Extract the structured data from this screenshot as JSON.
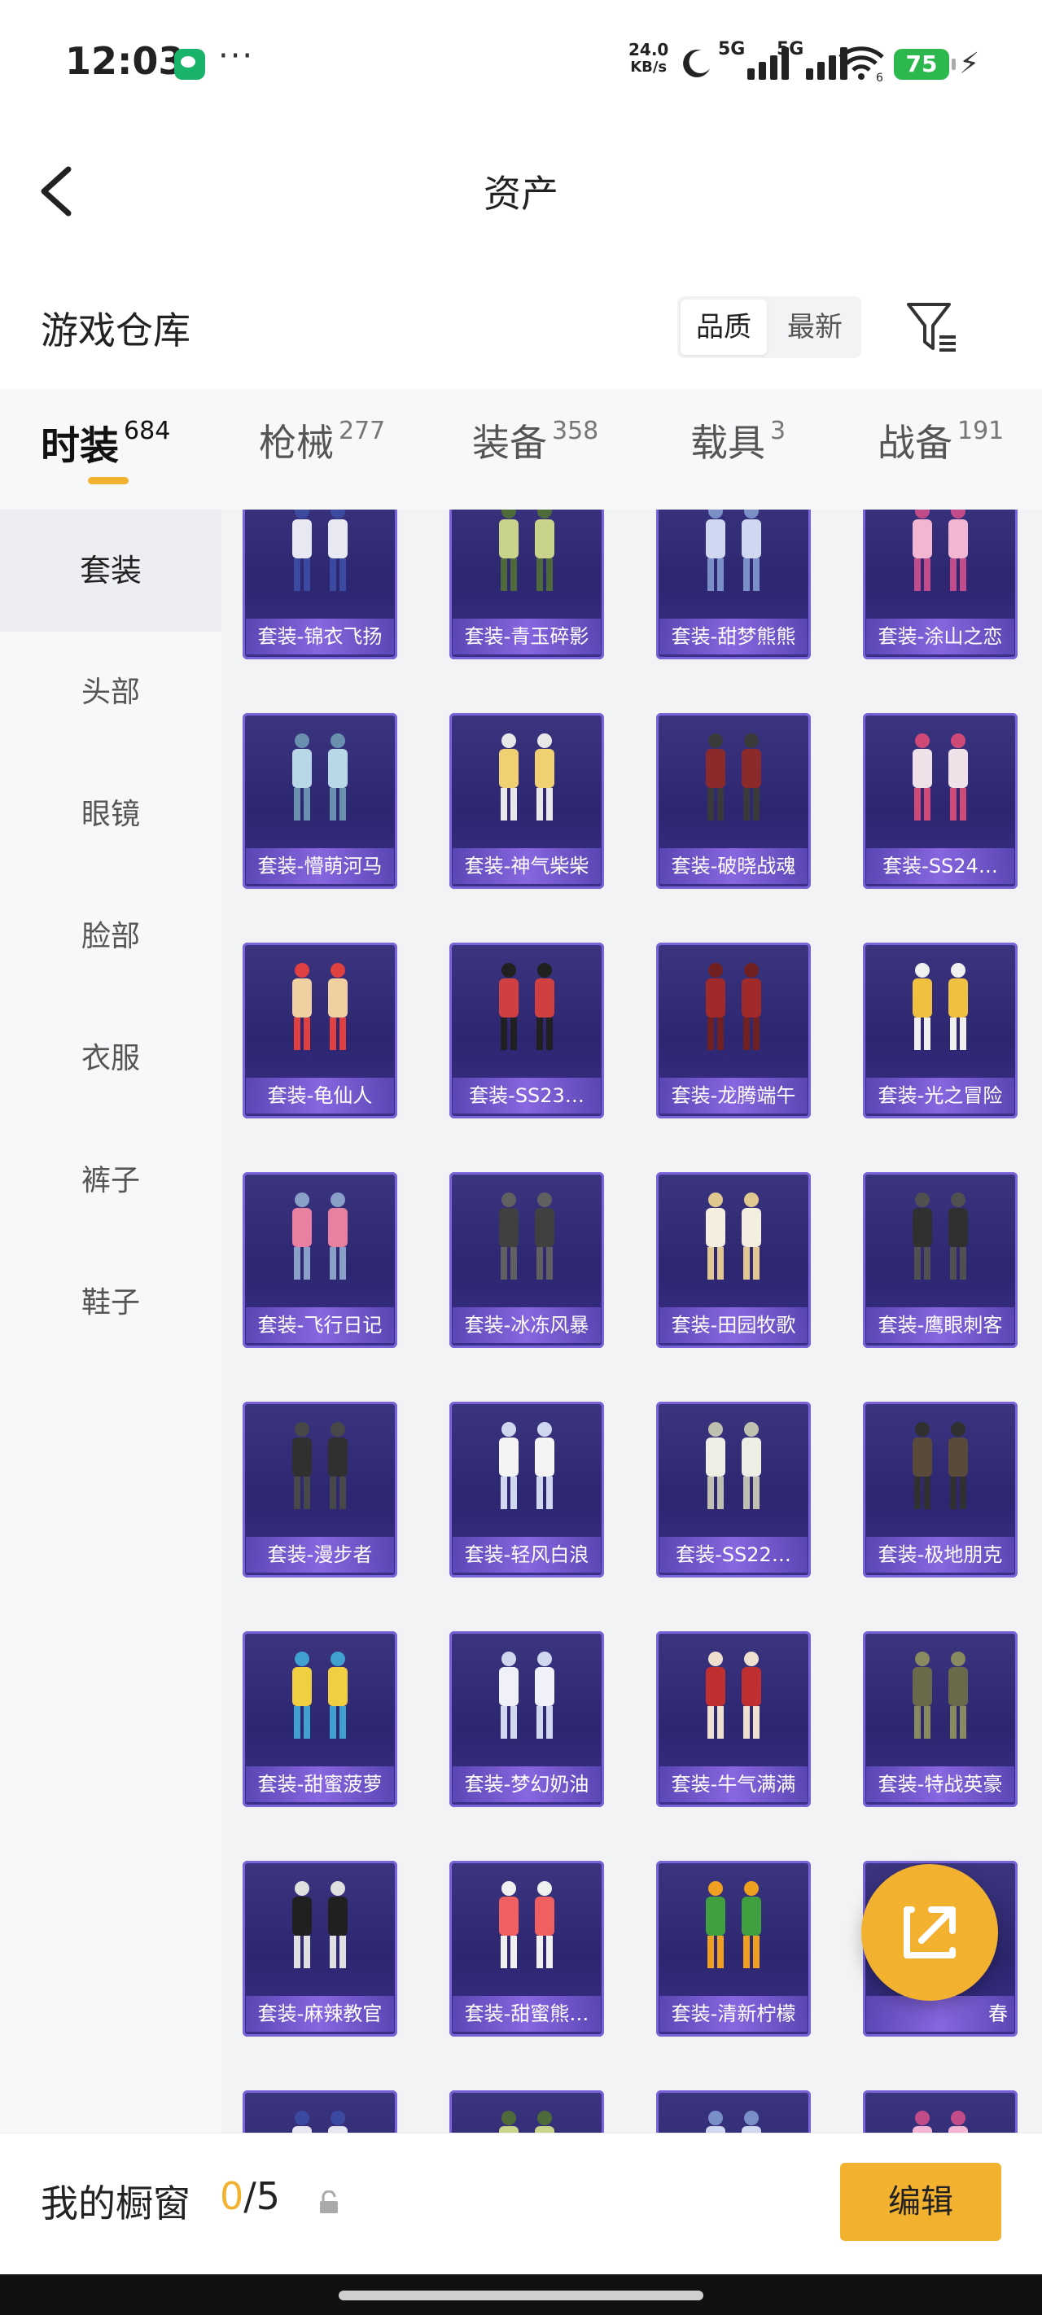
{
  "status_bar": {
    "time": "12:03",
    "more": "···",
    "net_speed": "24.0",
    "net_unit": "KB/s",
    "sim1": "5G",
    "sim2": "5G",
    "wifi_sub": "6",
    "battery": "75",
    "icons": [
      "wechat-icon",
      "moon-icon",
      "signal-icon",
      "signal-icon",
      "wifi-icon",
      "battery-icon",
      "charging-icon"
    ]
  },
  "header": {
    "title": "资产",
    "back_icon": "chevron-left-icon"
  },
  "warehouse": {
    "title": "游戏仓库",
    "sort_options": [
      {
        "label": "品质",
        "active": true
      },
      {
        "label": "最新",
        "active": false
      }
    ],
    "filter_icon": "filter-icon"
  },
  "category_tabs": [
    {
      "label": "时装",
      "count": "684",
      "active": true
    },
    {
      "label": "枪械",
      "count": "277",
      "active": false
    },
    {
      "label": "装备",
      "count": "358",
      "active": false
    },
    {
      "label": "载具",
      "count": "3",
      "active": false
    },
    {
      "label": "战备",
      "count": "191",
      "active": false
    }
  ],
  "sidebar": [
    {
      "label": "套装",
      "active": true
    },
    {
      "label": "头部",
      "active": false
    },
    {
      "label": "眼镜",
      "active": false
    },
    {
      "label": "脸部",
      "active": false
    },
    {
      "label": "衣服",
      "active": false
    },
    {
      "label": "裤子",
      "active": false
    },
    {
      "label": "鞋子",
      "active": false
    }
  ],
  "items": [
    {
      "label": "套装-锦衣飞扬"
    },
    {
      "label": "套装-青玉碎影"
    },
    {
      "label": "套装-甜梦熊熊"
    },
    {
      "label": "套装-涂山之恋"
    },
    {
      "label": "套装-懵萌河马"
    },
    {
      "label": "套装-神气柴柴"
    },
    {
      "label": "套装-破晓战魂"
    },
    {
      "label": "套装-SS24…"
    },
    {
      "label": "套装-龟仙人"
    },
    {
      "label": "套装-SS23…"
    },
    {
      "label": "套装-龙腾端午"
    },
    {
      "label": "套装-光之冒险"
    },
    {
      "label": "套装-飞行日记"
    },
    {
      "label": "套装-冰冻风暴"
    },
    {
      "label": "套装-田园牧歌"
    },
    {
      "label": "套装-鹰眼刺客"
    },
    {
      "label": "套装-漫步者"
    },
    {
      "label": "套装-轻风白浪"
    },
    {
      "label": "套装-SS22…"
    },
    {
      "label": "套装-极地朋克"
    },
    {
      "label": "套装-甜蜜菠萝"
    },
    {
      "label": "套装-梦幻奶油"
    },
    {
      "label": "套装-牛气满满"
    },
    {
      "label": "套装-特战英豪"
    },
    {
      "label": "套装-麻辣教官"
    },
    {
      "label": "套装-甜蜜熊…"
    },
    {
      "label": "套装-清新柠檬"
    },
    {
      "label": "春"
    }
  ],
  "share_icon": "external-link-icon",
  "bottom": {
    "label": "我的橱窗",
    "current": "0",
    "sep_total": "/5",
    "lock_icon": "lock-icon",
    "edit": "编辑"
  },
  "colors": {
    "accent": "#f2b230",
    "card_bg": "#2d2670",
    "card_border": "#7a63d8",
    "sidebar_bg": "#f7f8fa"
  }
}
